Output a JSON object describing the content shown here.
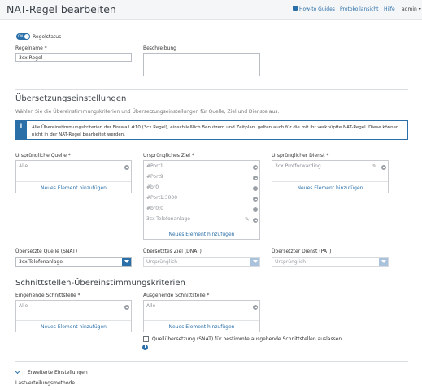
{
  "header": {
    "title": "NAT-Regel bearbeiten",
    "nav": {
      "how_to": "How-to Guides",
      "log": "Protokollansicht",
      "help": "Hilfe",
      "admin": "admin ▾"
    }
  },
  "rule_status": {
    "toggle_text": "ON",
    "label": "Regelstatus"
  },
  "rule_name": {
    "label": "Regelname *",
    "value": "3cx Regel"
  },
  "description": {
    "label": "Beschreibung",
    "value": ""
  },
  "translation": {
    "title": "Übersetzungseinstellungen",
    "subtitle": "Wählen Sie die Übereinstimmungskriterien und Übersetzungseinstellungen für Quelle, Ziel und Dienste aus.",
    "info_icon": "i",
    "info_text": "Alle Übereinstimmungskriterien der Firewall #10 (3cx Regel), einschließlich Benutzern und Zeitplan, gelten auch für die mit ihr verknüpfte NAT-Regel. Diese können nicht in der NAT-Regel bearbeitet werden.",
    "original_source": {
      "label": "Ursprüngliche Quelle *",
      "items": [
        "Alle"
      ],
      "add": "Neues Element hinzufügen"
    },
    "original_dest": {
      "label": "Ursprüngliches Ziel *",
      "items": [
        "#Port1",
        "#Port9",
        "#br0",
        "#Port1:3000",
        "#br0:0",
        "3cx-Telefonanlage"
      ],
      "add": "Neues Element hinzufügen"
    },
    "original_service": {
      "label": "Ursprünglicher Dienst *",
      "items": [
        "3cx Protforwarding"
      ],
      "add": "Neues Element hinzufügen"
    },
    "snat": {
      "label": "Übersetzte Quelle (SNAT)",
      "value": "3cx-Telefonanlage"
    },
    "dnat": {
      "label": "Übersetztes Ziel (DNAT)",
      "value": "Ursprünglich"
    },
    "pat": {
      "label": "Übersetzter Dienst (PAT)",
      "value": "Ursprünglich"
    }
  },
  "interface": {
    "title": "Schnittstellen-Übereinstimmungskriterien",
    "incoming": {
      "label": "Eingehende Schnittstelle *",
      "items": [
        "Alle"
      ],
      "add": "Neues Element hinzufügen"
    },
    "outgoing": {
      "label": "Ausgehende Schnittstelle *",
      "items": [
        "Alle"
      ],
      "add": "Neues Element hinzufügen"
    },
    "skip_snat": "Quellübersetzung (SNAT) für bestimmte ausgehende Schnittstellen auslassen",
    "info_icon": "i"
  },
  "advanced": {
    "label": "Erweiterte Einstellungen",
    "load_balancing": "Lastverteilungsmethode"
  },
  "colors": {
    "accent": "#2a6fa8",
    "border": "#c7cbd0",
    "muted_text": "#8a8f95"
  },
  "icons": [
    "document-icon",
    "toggle-switch",
    "info-icon",
    "minus-circle-icon",
    "pencil-icon",
    "dropdown-caret-icon",
    "checkbox",
    "chevron-down-icon"
  ]
}
